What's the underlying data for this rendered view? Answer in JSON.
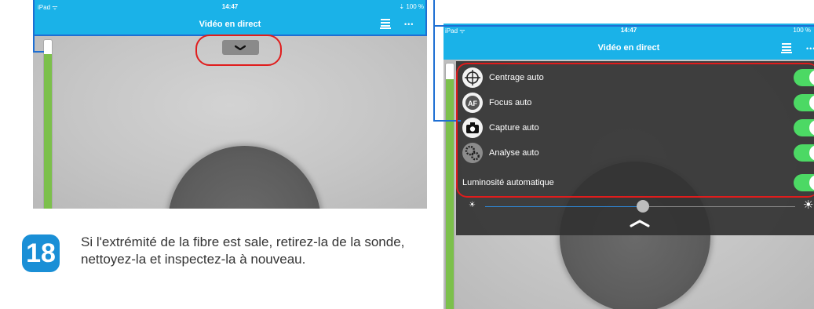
{
  "left_screen": {
    "status": {
      "carrier": "iPad ᯤ",
      "time": "14:47",
      "battery": "⇣ 100 %"
    },
    "nav_title": "Vidéo en direct",
    "icons": [
      "printer-icon",
      "more-icon",
      "chevron-down-icon"
    ],
    "progress_fraction": 0.92
  },
  "right_screen": {
    "status": {
      "carrier": "iPad ᯤ",
      "time": "14:47",
      "battery": "100 %"
    },
    "nav_title": "Vidéo en direct",
    "settings": [
      {
        "label": "Centrage auto",
        "icon": "crosshair-icon",
        "on": true
      },
      {
        "label": "Focus auto",
        "icon": "af-icon",
        "on": true
      },
      {
        "label": "Capture auto",
        "icon": "camera-icon",
        "on": true
      },
      {
        "label": "Analyse auto",
        "icon": "gears-icon",
        "on": true
      }
    ],
    "brightness_label": "Luminosité automatique",
    "brightness_on": true,
    "brightness_level": 0.51,
    "icons": [
      "sun-small-icon",
      "sun-large-icon",
      "chevron-up-icon",
      "printer-icon",
      "more-icon"
    ]
  },
  "step": {
    "number": "18",
    "text": "Si l'extrémité de la fibre est sale, retirez-la de la sonde, nettoyez-la et inspectez-la à nouveau."
  },
  "colors": {
    "nav_blue": "#1ab2e8",
    "toggle_green": "#4cd964",
    "callout_blue": "#1e6fd3",
    "highlight_red": "#e01c1c",
    "badge_blue": "#1a8fd6",
    "progress_green": "#7cc04b"
  }
}
